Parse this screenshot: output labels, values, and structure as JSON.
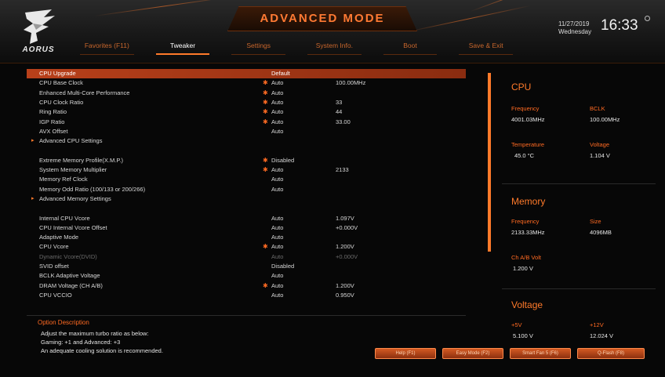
{
  "header": {
    "title": "ADVANCED MODE",
    "logo_text": "AORUS",
    "tabs": [
      {
        "label": "Favorites (F11)"
      },
      {
        "label": "Tweaker"
      },
      {
        "label": "Settings"
      },
      {
        "label": "System Info."
      },
      {
        "label": "Boot"
      },
      {
        "label": "Save & Exit"
      }
    ],
    "date": "11/27/2019",
    "day": "Wednesday",
    "time": "16:33"
  },
  "settings": [
    {
      "name": "CPU Upgrade",
      "value": "Default",
      "extra": "",
      "star": false,
      "selected": true,
      "submenu": false,
      "dim": false
    },
    {
      "name": "CPU Base Clock",
      "value": "Auto",
      "extra": "100.00MHz",
      "star": true,
      "selected": false,
      "submenu": false,
      "dim": false
    },
    {
      "name": "Enhanced Multi-Core Performance",
      "value": "Auto",
      "extra": "",
      "star": true,
      "selected": false,
      "submenu": false,
      "dim": false
    },
    {
      "name": "CPU Clock Ratio",
      "value": "Auto",
      "extra": "33",
      "star": true,
      "selected": false,
      "submenu": false,
      "dim": false
    },
    {
      "name": "Ring Ratio",
      "value": "Auto",
      "extra": "44",
      "star": true,
      "selected": false,
      "submenu": false,
      "dim": false
    },
    {
      "name": "IGP Ratio",
      "value": "Auto",
      "extra": "33.00",
      "star": true,
      "selected": false,
      "submenu": false,
      "dim": false
    },
    {
      "name": "AVX Offset",
      "value": "Auto",
      "extra": "",
      "star": false,
      "selected": false,
      "submenu": false,
      "dim": false
    },
    {
      "name": "Advanced CPU Settings",
      "value": "",
      "extra": "",
      "star": false,
      "selected": false,
      "submenu": true,
      "dim": false
    },
    {
      "name": "",
      "value": "",
      "extra": "",
      "star": false,
      "selected": false,
      "submenu": false,
      "dim": false,
      "spacer": true
    },
    {
      "name": "Extreme Memory Profile(X.M.P.)",
      "value": "Disabled",
      "extra": "",
      "star": true,
      "selected": false,
      "submenu": false,
      "dim": false
    },
    {
      "name": "System Memory Multiplier",
      "value": "Auto",
      "extra": "2133",
      "star": true,
      "selected": false,
      "submenu": false,
      "dim": false
    },
    {
      "name": "Memory Ref Clock",
      "value": "Auto",
      "extra": "",
      "star": false,
      "selected": false,
      "submenu": false,
      "dim": false
    },
    {
      "name": "Memory Odd Ratio (100/133 or 200/266)",
      "value": "Auto",
      "extra": "",
      "star": false,
      "selected": false,
      "submenu": false,
      "dim": false
    },
    {
      "name": "Advanced Memory Settings",
      "value": "",
      "extra": "",
      "star": false,
      "selected": false,
      "submenu": true,
      "dim": false
    },
    {
      "name": "",
      "value": "",
      "extra": "",
      "star": false,
      "selected": false,
      "submenu": false,
      "dim": false,
      "spacer": true
    },
    {
      "name": "Internal CPU Vcore",
      "value": "Auto",
      "extra": "1.097V",
      "star": false,
      "selected": false,
      "submenu": false,
      "dim": false
    },
    {
      "name": "CPU Internal Vcore Offset",
      "value": "Auto",
      "extra": "+0.000V",
      "star": false,
      "selected": false,
      "submenu": false,
      "dim": false
    },
    {
      "name": "Adaptive Mode",
      "value": "Auto",
      "extra": "",
      "star": false,
      "selected": false,
      "submenu": false,
      "dim": false
    },
    {
      "name": "CPU Vcore",
      "value": "Auto",
      "extra": "1.200V",
      "star": true,
      "selected": false,
      "submenu": false,
      "dim": false
    },
    {
      "name": "Dynamic Vcore(DVID)",
      "value": "Auto",
      "extra": "+0.000V",
      "star": false,
      "selected": false,
      "submenu": false,
      "dim": true
    },
    {
      "name": "SVID offset",
      "value": "Disabled",
      "extra": "",
      "star": false,
      "selected": false,
      "submenu": false,
      "dim": false
    },
    {
      "name": "BCLK Adaptive Voltage",
      "value": "Auto",
      "extra": "",
      "star": false,
      "selected": false,
      "submenu": false,
      "dim": false
    },
    {
      "name": "DRAM Voltage    (CH A/B)",
      "value": "Auto",
      "extra": "1.200V",
      "star": true,
      "selected": false,
      "submenu": false,
      "dim": false
    },
    {
      "name": "CPU VCCIO",
      "value": "Auto",
      "extra": "0.950V",
      "star": false,
      "selected": false,
      "submenu": false,
      "dim": false
    }
  ],
  "description": {
    "title": "Option Description",
    "line1": "Adjust the maximum turbo ratio as below:",
    "line2": "Gaming: +1 and Advanced: +3",
    "line3": "An adequate cooling solution is recommended."
  },
  "panel": {
    "cpu": {
      "title": "CPU",
      "freq_label": "Frequency",
      "freq_value": "4001.03MHz",
      "bclk_label": "BCLK",
      "bclk_value": "100.00MHz",
      "temp_label": "Temperature",
      "temp_value": "45.0 °C",
      "volt_label": "Voltage",
      "volt_value": "1.104 V"
    },
    "memory": {
      "title": "Memory",
      "freq_label": "Frequency",
      "freq_value": "2133.33MHz",
      "size_label": "Size",
      "size_value": "4096MB",
      "ch_label": "Ch A/B Volt",
      "ch_value": "1.200 V"
    },
    "voltage": {
      "title": "Voltage",
      "v5_label": "+5V",
      "v5_value": "5.100 V",
      "v12_label": "+12V",
      "v12_value": "12.024 V"
    }
  },
  "footer": {
    "buttons": [
      {
        "label": "Help (F1)"
      },
      {
        "label": "Easy Mode (F2)"
      },
      {
        "label": "Smart Fan 5 (F6)"
      },
      {
        "label": "Q-Flash (F8)"
      }
    ]
  },
  "colors": {
    "accent": "#ff7a2a",
    "selection": "#b8401a",
    "background": "#070707"
  }
}
